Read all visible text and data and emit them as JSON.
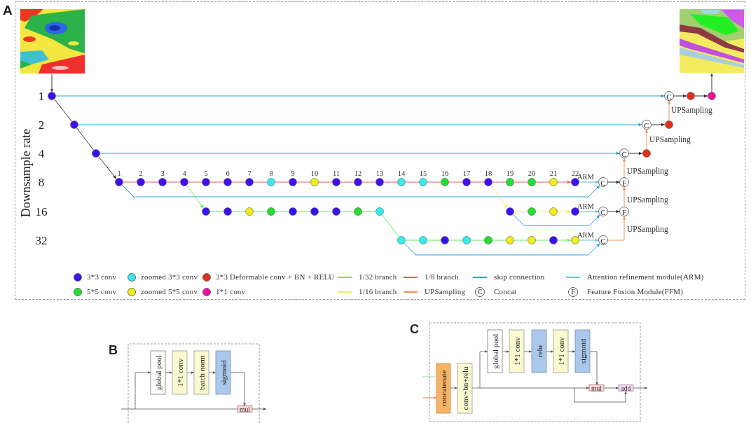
{
  "panel_a": {
    "label": "A",
    "axis_title": "Downsample rate",
    "rate_labels": [
      "1",
      "2",
      "4",
      "8",
      "16",
      "32"
    ],
    "layer_numbers": [
      "1",
      "2",
      "3",
      "4",
      "5",
      "6",
      "7",
      "8",
      "9",
      "10",
      "11",
      "12",
      "13",
      "14",
      "15",
      "16",
      "17",
      "18",
      "19",
      "20",
      "21",
      "22"
    ],
    "stem_nodes": [
      {
        "kind": "conv3"
      },
      {
        "kind": "conv3"
      },
      {
        "kind": "conv3"
      }
    ],
    "branch_8": [
      {
        "kind": "conv3"
      },
      {
        "kind": "conv3"
      },
      {
        "kind": "conv3"
      },
      {
        "kind": "conv3"
      },
      {
        "kind": "conv3"
      },
      {
        "kind": "conv3"
      },
      {
        "kind": "conv3"
      },
      {
        "kind": "zconv3"
      },
      {
        "kind": "conv3"
      },
      {
        "kind": "zconv5"
      },
      {
        "kind": "conv3"
      },
      {
        "kind": "conv3"
      },
      {
        "kind": "conv3"
      },
      {
        "kind": "zconv3"
      },
      {
        "kind": "zconv3"
      },
      {
        "kind": "conv5"
      },
      {
        "kind": "conv3"
      },
      {
        "kind": "conv3"
      },
      {
        "kind": "conv5"
      },
      {
        "kind": "conv5"
      },
      {
        "kind": "zconv5"
      },
      {
        "kind": "conv3"
      }
    ],
    "branch_16": [
      {
        "kind": "conv3"
      },
      {
        "kind": "conv3"
      },
      {
        "kind": "zconv5"
      },
      {
        "kind": "conv5"
      },
      {
        "kind": "conv3"
      },
      {
        "kind": "conv3"
      },
      {
        "kind": "conv3"
      },
      {
        "kind": "conv5"
      },
      {
        "kind": "zconv3"
      }
    ],
    "branch_16_late": [
      {
        "kind": "conv3"
      },
      {
        "kind": "conv5"
      },
      {
        "kind": "zconv5"
      },
      {
        "kind": "conv3"
      }
    ],
    "branch_32": [
      {
        "kind": "zconv3"
      },
      {
        "kind": "zconv3"
      },
      {
        "kind": "conv3"
      },
      {
        "kind": "zconv3"
      },
      {
        "kind": "conv5"
      },
      {
        "kind": "zconv5"
      },
      {
        "kind": "zconv5"
      },
      {
        "kind": "conv3"
      },
      {
        "kind": "zconv5"
      }
    ],
    "arm_labels": [
      "ARM",
      "ARM",
      "ARM"
    ],
    "concat_symbols": [
      "C",
      "C",
      "C",
      "C",
      "C",
      "C"
    ],
    "ffm_symbols": [
      "F",
      "F"
    ],
    "decoder_nodes": [
      {
        "kind": "deform"
      },
      {
        "kind": "conv1"
      },
      {
        "kind": "deform"
      },
      {
        "kind": "deform"
      }
    ],
    "upsampling_labels": [
      "UPSampling",
      "UPSampling",
      "UPSampling",
      "UPSampling",
      "UPSampling"
    ]
  },
  "legend": [
    {
      "kind": "dot",
      "color": "#3a10ee",
      "label": "3*3 conv"
    },
    {
      "kind": "dot",
      "color": "#33eef0",
      "label": "zoomed 3*3 conv"
    },
    {
      "kind": "dot",
      "color": "#e2301c",
      "label": "3*3 Deformable conv + BN + RELU"
    },
    {
      "kind": "line",
      "color": "#5cf05c",
      "label": "1/32 branch"
    },
    {
      "kind": "line",
      "color": "#f25a5a",
      "label": "1/8 branch"
    },
    {
      "kind": "line",
      "color": "#2aa0e6",
      "label": "skip connection"
    },
    {
      "kind": "line",
      "color": "#62c6d6",
      "label": "Attention refinement module(ARM)"
    },
    {
      "kind": "dot",
      "color": "#22e030",
      "label": "5*5 conv"
    },
    {
      "kind": "dot",
      "color": "#f2ee1a",
      "label": "zoomed 5*5 conv"
    },
    {
      "kind": "dot",
      "color": "#ee10a0",
      "label": "1*1 conv"
    },
    {
      "kind": "line",
      "color": "#f2f05a",
      "label": "1/16 branch"
    },
    {
      "kind": "line",
      "color": "#f2905a",
      "label": "UPSampling"
    },
    {
      "kind": "symbol",
      "symbol": "C",
      "label": "Concat"
    },
    {
      "kind": "symbol",
      "symbol": "F",
      "label": "Feature Fusion Module(FFM)"
    }
  ],
  "panel_b": {
    "label": "B",
    "blocks": [
      {
        "kind": "pool",
        "text": "global pool"
      },
      {
        "kind": "conv",
        "text": "1*1 conv"
      },
      {
        "kind": "norm",
        "text": "batch norm"
      },
      {
        "kind": "activation",
        "text": "sigmoid"
      }
    ],
    "operations": [
      {
        "kind": "mul",
        "text": "mul"
      }
    ]
  },
  "panel_c": {
    "label": "C",
    "input_blocks": [
      {
        "kind": "concat",
        "text": "concatenate"
      },
      {
        "kind": "conv",
        "text": "conv+bn+relu"
      }
    ],
    "attention_blocks": [
      {
        "kind": "pool",
        "text": "global pool"
      },
      {
        "kind": "conv",
        "text": "1*1 conv"
      },
      {
        "kind": "activation",
        "text": "relu"
      },
      {
        "kind": "conv",
        "text": "1*1 conv"
      },
      {
        "kind": "activation",
        "text": "sigmoid"
      }
    ],
    "operations": [
      {
        "kind": "mul",
        "text": "mul"
      },
      {
        "kind": "add",
        "text": "add"
      }
    ]
  }
}
